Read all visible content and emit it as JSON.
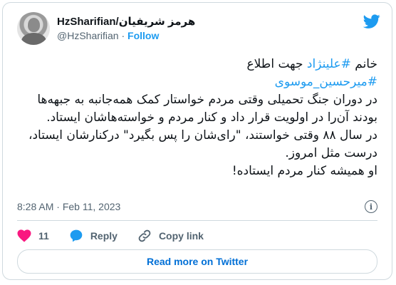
{
  "author": {
    "display_name": "HzSharifian/هرمز شریفیان",
    "handle": "@HzSharifian",
    "separator": "·",
    "follow_label": "Follow"
  },
  "tweet": {
    "lines": [
      {
        "prefix": "خانم ",
        "hashtag": "#علینژاد",
        "suffix": " جهت اطلاع"
      },
      {
        "prefix": "",
        "hashtag": "#میرحسین_موسوی",
        "suffix": ""
      },
      {
        "text": "در دوران جنگ تحمیلی وقتی مردم خواستار کمک همه‌جانبه به جبهه‌ها بودند آن‌را در اولویت قرار داد و کنار مردم و خواسته‌هاشان ایستاد."
      },
      {
        "text": "در سال ۸۸ وقتی خواستند، \"رای‌شان را پس بگیرد\" درکنارشان ایستاد، درست مثل امروز."
      },
      {
        "text": "او همیشه کنار مردم ایستاده!"
      }
    ]
  },
  "meta": {
    "time": "8:28 AM",
    "separator": "·",
    "date": "Feb 11, 2023",
    "info_icon": "i"
  },
  "actions": {
    "like_count": "11",
    "reply_label": "Reply",
    "copy_link_label": "Copy link"
  },
  "read_more_label": "Read more on Twitter",
  "colors": {
    "accent": "#1d9bf0",
    "like": "#f91880",
    "text": "#0f1419",
    "muted": "#536471",
    "border": "#cfd9de"
  }
}
